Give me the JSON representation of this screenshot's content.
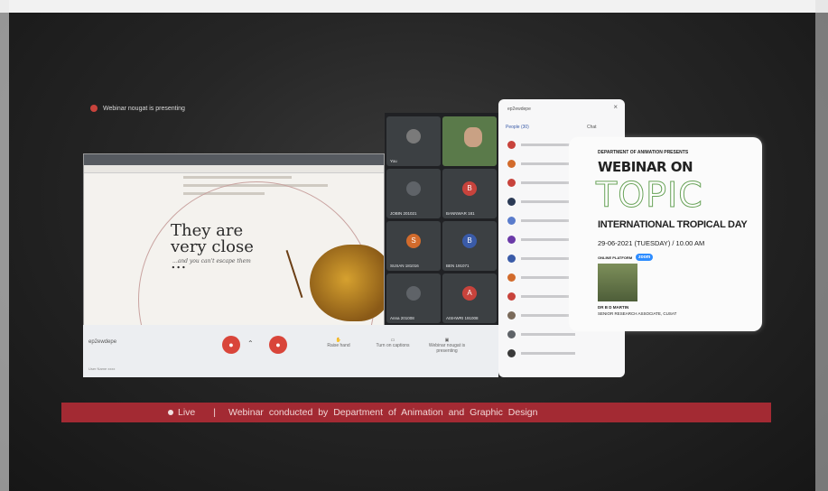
{
  "presenting_text": "Webinar nougat is presenting",
  "shared_screen": {
    "hero_title": "They are very close ...",
    "hero_subtitle": "...and you can't escape them"
  },
  "participants": [
    {
      "name": "You",
      "color": "#c8433c",
      "initial": ""
    },
    {
      "name": "JOBIN 201021",
      "color": "#5f6368",
      "initial": ""
    },
    {
      "name": "BANNWAR 181",
      "color": "#c8433c",
      "initial": "B"
    },
    {
      "name": "SUSAN 181016",
      "color": "#d26b2c",
      "initial": "S"
    },
    {
      "name": "BEN 191071",
      "color": "#3a5ba8",
      "initial": "B"
    },
    {
      "name": "Anna 201008",
      "color": "#5f6368",
      "initial": ""
    },
    {
      "name": "AISHWRI 191008",
      "color": "#c8433c",
      "initial": "A"
    }
  ],
  "people_panel": {
    "header": "ep2ewdepe",
    "tab_people": "People (30)",
    "tab_chat": "Chat",
    "avatar_colors": [
      "#c8433c",
      "#d26b2c",
      "#c8433c",
      "#2b3a55",
      "#5a7ccc",
      "#6b3aa8",
      "#3a5ba8",
      "#d26b2c",
      "#c8433c",
      "#7a6a5a",
      "#5f6368",
      "#3a3a3a"
    ]
  },
  "bottom_bar": {
    "meeting_code": "ep2ewdepe",
    "raise_hand": "Raise hand",
    "turn_on_captions": "Turn on captions",
    "presenting_label": "Webinar nougat is presenting",
    "foot": "User Name xxxx"
  },
  "poster": {
    "dept": "DEPARTMENT OF ANIMATION PRESENTS",
    "webinar_on": "WEBINAR ON",
    "topic": "TOPIC",
    "event": "INTERNATIONAL TROPICAL DAY",
    "date": "29-06-2021 (TUESDAY) / 10.00 AM",
    "platform_label": "ONLINE PLATFORM",
    "platform": "zoom",
    "speaker": "DR B D MARTIN",
    "speaker_title": "SENIOR RESEARCH ASSOCIATE, CUSAT"
  },
  "ticker": {
    "live": "Live",
    "separator": "|",
    "message": "Webinar conducted by Department of Animation and Graphic Design"
  }
}
